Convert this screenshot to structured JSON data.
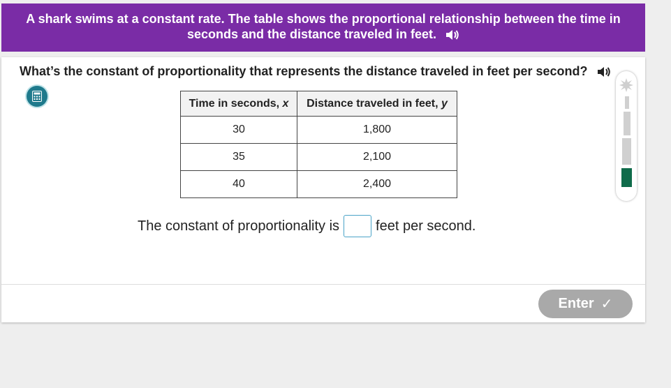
{
  "header": {
    "line1": "A shark swims at a constant rate. The table shows the proportional relationship between the time in",
    "line2": "seconds and the distance traveled in feet.",
    "speaker_icon": "speaker-icon"
  },
  "question": {
    "text": "What’s the constant of proportionality that represents the distance traveled in feet per second?",
    "speaker_icon": "speaker-icon"
  },
  "tools": {
    "calculator_icon": "calculator-icon"
  },
  "table": {
    "headers": [
      {
        "label": "Time in seconds, ",
        "var": "x"
      },
      {
        "label": "Distance traveled in feet, ",
        "var": "y"
      }
    ],
    "rows": [
      [
        "30",
        "1,800"
      ],
      [
        "35",
        "2,100"
      ],
      [
        "40",
        "2,400"
      ]
    ]
  },
  "answer": {
    "prefix": "The constant of proportionality is",
    "value": "",
    "suffix": "feet per second."
  },
  "enter_button": {
    "label": "Enter",
    "check": "✓",
    "color": "#a9a9a9"
  },
  "progress": {
    "level": 1,
    "total": 4,
    "filled_color": "#0f6b4a"
  },
  "colors": {
    "banner": "#7a2ca6",
    "calculator": "#1f7a8c"
  }
}
